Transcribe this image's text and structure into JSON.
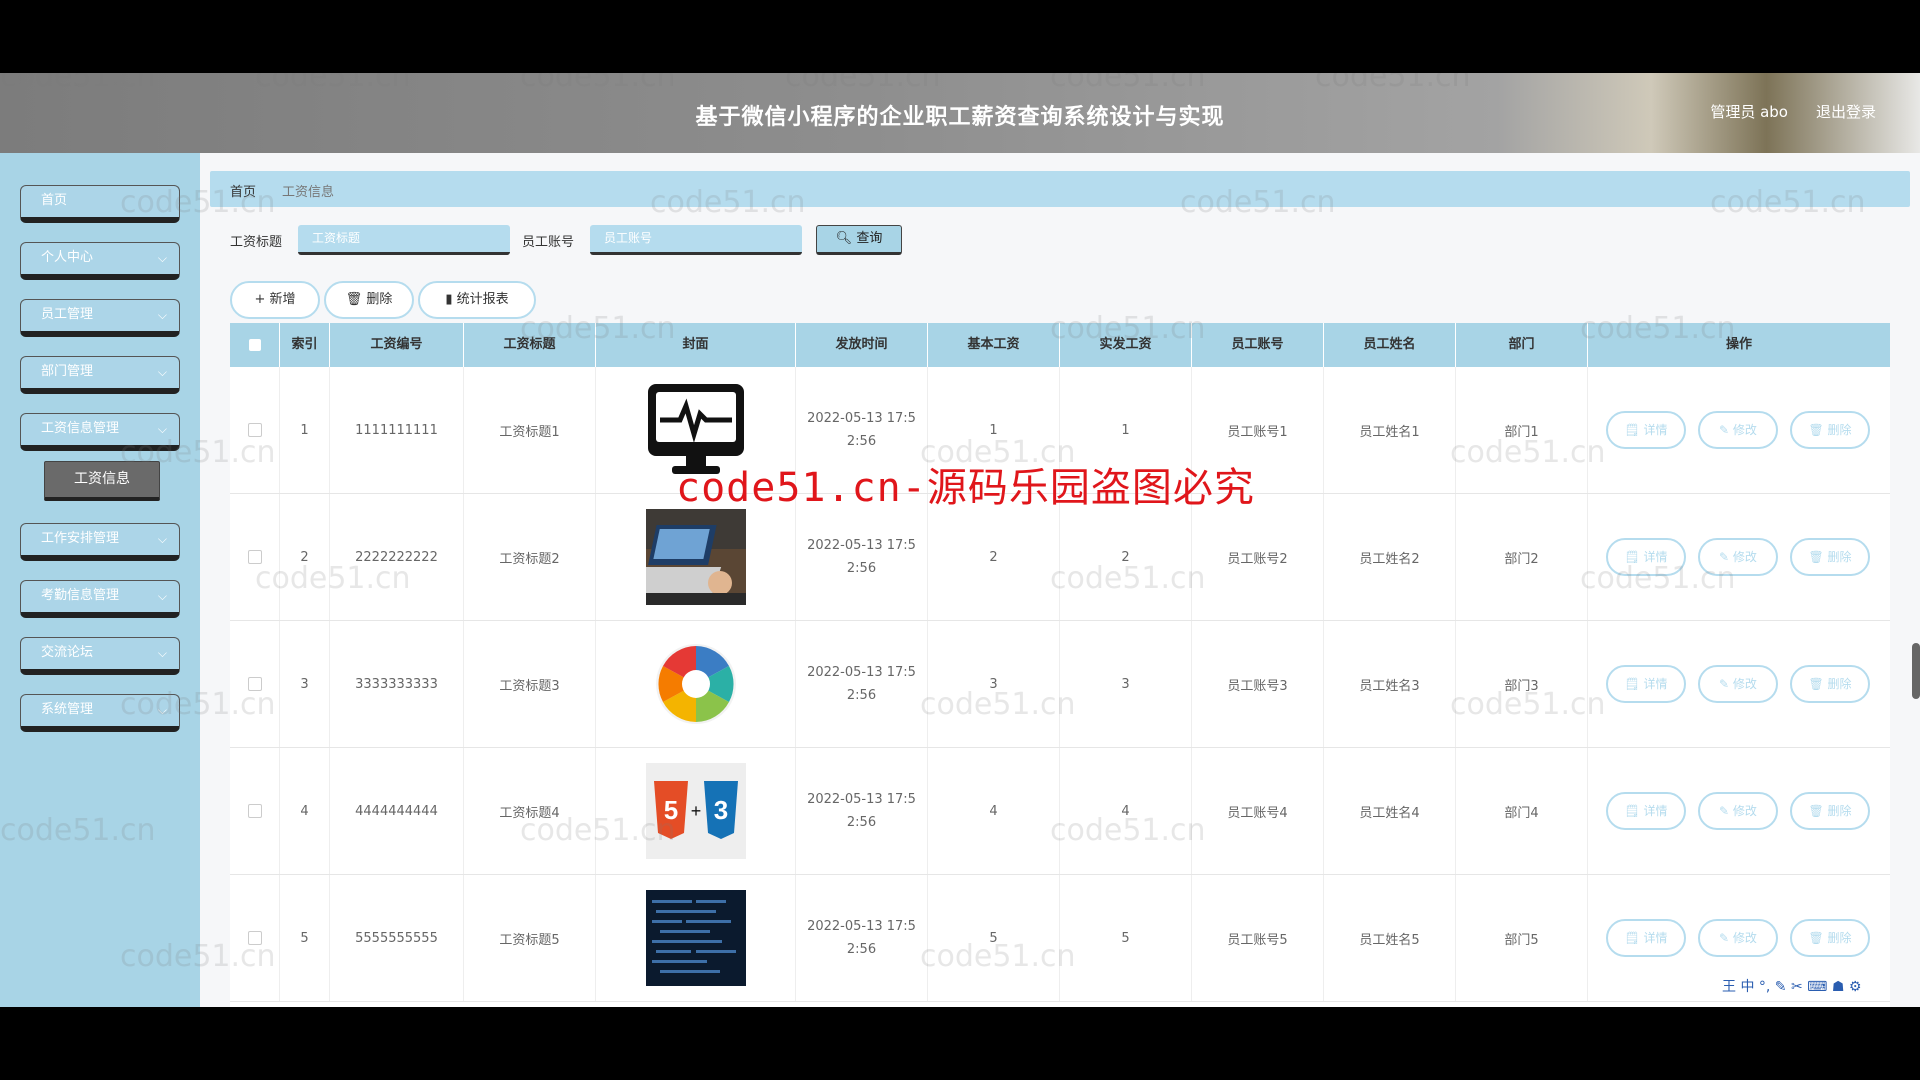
{
  "header": {
    "title": "基于微信小程序的企业职工薪资查询系统设计与实现",
    "user": "管理员 abo",
    "logout": "退出登录"
  },
  "sidebar": {
    "items": [
      {
        "label": "首页",
        "has_chevron": false
      },
      {
        "label": "个人中心",
        "has_chevron": true
      },
      {
        "label": "员工管理",
        "has_chevron": true
      },
      {
        "label": "部门管理",
        "has_chevron": true
      },
      {
        "label": "工资信息管理",
        "has_chevron": true
      },
      {
        "label": "工作安排管理",
        "has_chevron": true
      },
      {
        "label": "考勤信息管理",
        "has_chevron": true
      },
      {
        "label": "交流论坛",
        "has_chevron": true
      },
      {
        "label": "系统管理",
        "has_chevron": true
      }
    ],
    "submenu": {
      "label": "工资信息"
    }
  },
  "breadcrumb": {
    "home": "首页",
    "current": "工资信息"
  },
  "search": {
    "title_label": "工资标题",
    "title_placeholder": "工资标题",
    "account_label": "员工账号",
    "account_placeholder": "员工账号",
    "query_label": "查询"
  },
  "actions": {
    "add": "新增",
    "delete": "删除",
    "report": "统计报表"
  },
  "table": {
    "headers": [
      "索引",
      "工资编号",
      "工资标题",
      "封面",
      "发放时间",
      "基本工资",
      "实发工资",
      "员工账号",
      "员工姓名",
      "部门",
      "操作"
    ],
    "rows": [
      {
        "index": "1",
        "code": "1111111111",
        "title": "工资标题1",
        "cover": "monitor-icon",
        "time1": "2022-05-13 17:5",
        "time2": "2:56",
        "base": "1",
        "actual": "1",
        "account": "员工账号1",
        "name": "员工姓名1",
        "dept": "部门1"
      },
      {
        "index": "2",
        "code": "2222222222",
        "title": "工资标题2",
        "cover": "laptop-photo",
        "time1": "2022-05-13 17:5",
        "time2": "2:56",
        "base": "2",
        "actual": "2",
        "account": "员工账号2",
        "name": "员工姓名2",
        "dept": "部门2"
      },
      {
        "index": "3",
        "code": "3333333333",
        "title": "工资标题3",
        "cover": "wheel-diagram",
        "time1": "2022-05-13 17:5",
        "time2": "2:56",
        "base": "3",
        "actual": "3",
        "account": "员工账号3",
        "name": "员工姓名3",
        "dept": "部门3"
      },
      {
        "index": "4",
        "code": "4444444444",
        "title": "工资标题4",
        "cover": "html5-css3-logo",
        "time1": "2022-05-13 17:5",
        "time2": "2:56",
        "base": "4",
        "actual": "4",
        "account": "员工账号4",
        "name": "员工姓名4",
        "dept": "部门4"
      },
      {
        "index": "5",
        "code": "5555555555",
        "title": "工资标题5",
        "cover": "code-photo",
        "time1": "2022-05-13 17:5",
        "time2": "2:56",
        "base": "5",
        "actual": "5",
        "account": "员工账号5",
        "name": "员工姓名5",
        "dept": "部门5"
      }
    ],
    "op_labels": {
      "detail": "详情",
      "edit": "修改",
      "delete": "删除"
    }
  },
  "watermark": {
    "text": "code51.cn",
    "banner": "code51.cn-源码乐园盗图必究"
  },
  "ime": {
    "text": "王 中 °, ✎ ✂ ⌨ ☗ ⚙"
  },
  "colors": {
    "accent": "#a8d4e6",
    "header_bg": "#8e8e8e",
    "banner_red": "#e0161b"
  }
}
